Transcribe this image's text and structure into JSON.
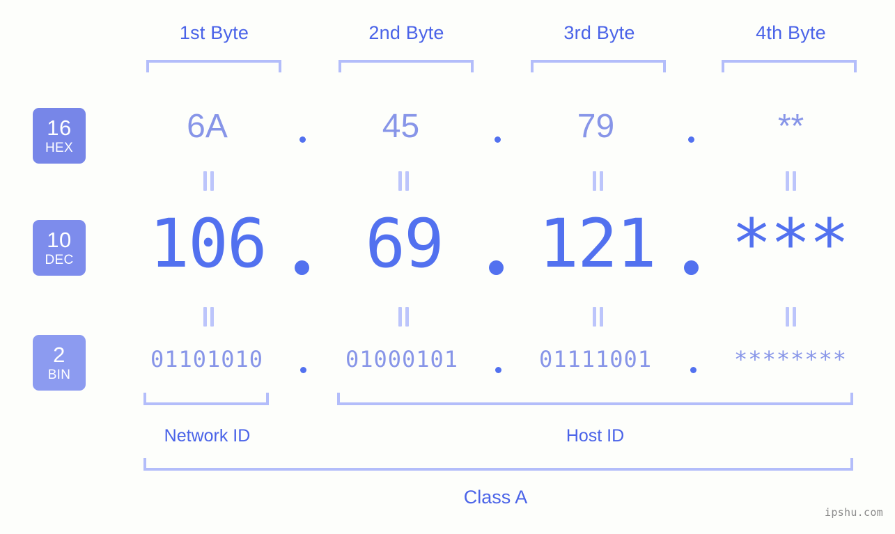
{
  "meta": {
    "watermark": "ipshu.com"
  },
  "byte_headers": [
    {
      "label": "1st Byte"
    },
    {
      "label": "2nd Byte"
    },
    {
      "label": "3rd Byte"
    },
    {
      "label": "4th Byte"
    }
  ],
  "bases": [
    {
      "number": "16",
      "name": "HEX",
      "color": "#7786e8"
    },
    {
      "number": "10",
      "name": "DEC",
      "color": "#7d8cec"
    },
    {
      "number": "2",
      "name": "BIN",
      "color": "#8c9bf0"
    }
  ],
  "rows": {
    "hex": {
      "base_number": "16",
      "base_name": "HEX",
      "values": [
        "6A",
        "45",
        "79",
        "**"
      ],
      "separator": "."
    },
    "dec": {
      "base_number": "10",
      "base_name": "DEC",
      "values": [
        "106",
        "69",
        "121",
        "***"
      ],
      "separator": "."
    },
    "bin": {
      "base_number": "2",
      "base_name": "BIN",
      "values": [
        "01101010",
        "01000101",
        "01111001",
        "********"
      ],
      "separator": "."
    }
  },
  "equals_marks": {
    "hex_to_dec": [
      "=",
      "=",
      "=",
      "="
    ],
    "dec_to_bin": [
      "=",
      "=",
      "=",
      "="
    ]
  },
  "sections": {
    "network_id": "Network ID",
    "host_id": "Host ID",
    "ip_class": "Class A"
  },
  "colors": {
    "background": "#fdfefb",
    "accent_strong": "#4a63e8",
    "accent_value": "#5271ef",
    "accent_light": "#8795e8",
    "bracket": "#b3bdfa",
    "equals": "#bcc5fb",
    "badge_text": "#ffffff",
    "watermark": "#8a8a8a"
  }
}
